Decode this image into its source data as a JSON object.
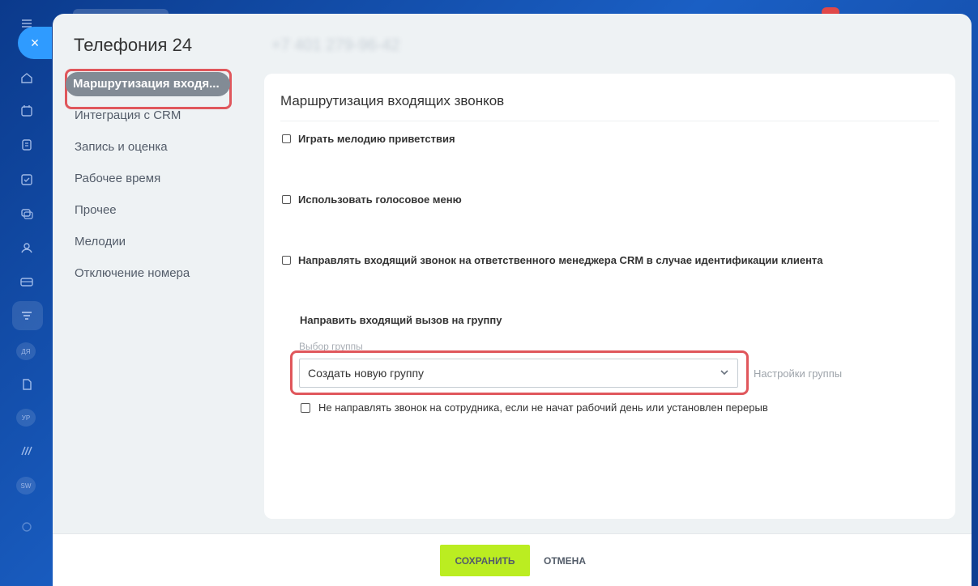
{
  "header": {
    "title": "Телефония 24",
    "phone": "+7 401 279-96-42"
  },
  "close_icon": "×",
  "nav": {
    "items": [
      {
        "label": "Маршрутизация входя..."
      },
      {
        "label": "Интеграция с CRM"
      },
      {
        "label": "Запись и оценка"
      },
      {
        "label": "Рабочее время"
      },
      {
        "label": "Прочее"
      },
      {
        "label": "Мелодии"
      },
      {
        "label": "Отключение номера"
      }
    ]
  },
  "rail": {
    "small_labels": [
      "ДЯ",
      "УР",
      "SW"
    ],
    "icons": [
      "menu-icon",
      "home-icon",
      "calendar-icon",
      "document-icon",
      "tasks-icon",
      "chat-icon",
      "contacts-icon",
      "card-icon",
      "filter-icon",
      "file-icon",
      "brand-icon",
      "settings-icon"
    ]
  },
  "content": {
    "heading": "Маршрутизация входящих звонков",
    "options": [
      {
        "label": "Играть мелодию приветствия",
        "checked": false
      },
      {
        "label": "Использовать голосовое меню",
        "checked": false
      },
      {
        "label": "Направлять входящий звонок на ответственного менеджера CRM в случае идентификации клиента",
        "checked": false
      }
    ],
    "group_title": "Направить входящий вызов на группу",
    "group_label": "Выбор группы",
    "group_select": {
      "value": "Создать новую группу"
    },
    "group_settings": "Настройки группы",
    "workday_option": {
      "label": "Не направлять звонок на сотрудника, если не начат рабочий день или установлен перерыв",
      "checked": false
    }
  },
  "footer": {
    "save_label": "СОХРАНИТЬ",
    "cancel_label": "ОТМЕНА"
  },
  "colors": {
    "save": "#bbed21",
    "highlight": "#e0575c",
    "active_nav": "#828b95",
    "close": "#2f9bff"
  }
}
